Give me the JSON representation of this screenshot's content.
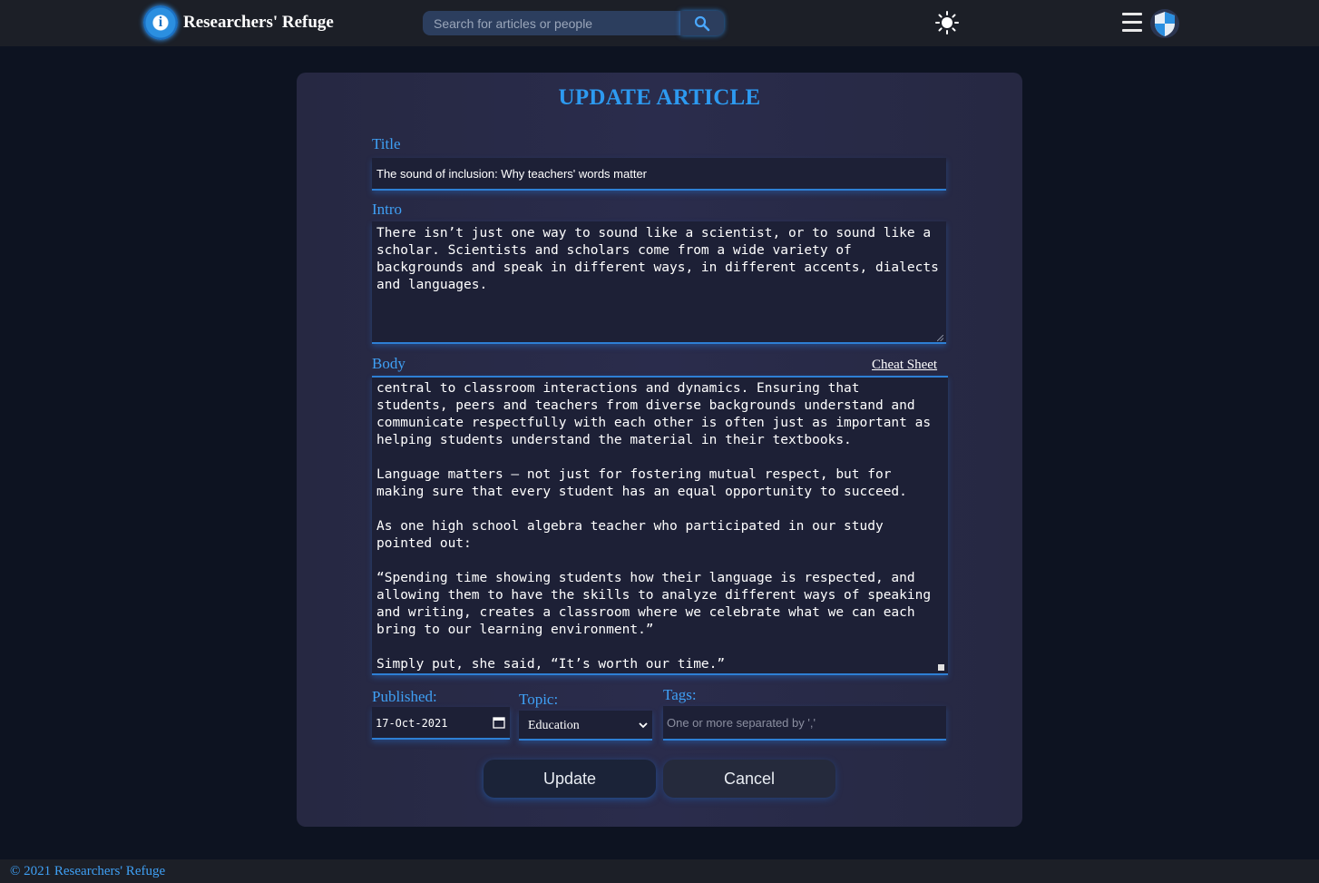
{
  "app": {
    "brand_name": "Researchers' Refuge",
    "search_placeholder": "Search for articles or people"
  },
  "icons": {
    "logo": "logo-icon",
    "search": "search-icon",
    "theme": "sun-icon",
    "menu": "hamburger-menu-icon",
    "profile": "shield-icon",
    "calendar": "calendar-icon",
    "select": "chevron-down-icon"
  },
  "colors": {
    "accent": "#2d9af0",
    "background": "#0d1321",
    "card": "#2a2c4c"
  },
  "form": {
    "heading": "UPDATE ARTICLE",
    "title_label": "Title",
    "title_value": "The sound of inclusion: Why teachers' words matter",
    "intro_label": "Intro",
    "intro_value": "There isn’t just one way to sound like a scientist, or to sound like a\nscholar. Scientists and scholars come from a wide variety of\nbackgrounds and speak in different ways, in different accents, dialects\nand languages.",
    "body_label": "Body",
    "cheat_sheet_label": "Cheat Sheet",
    "body_value": "central to classroom interactions and dynamics. Ensuring that\nstudents, peers and teachers from diverse backgrounds understand and\ncommunicate respectfully with each other is often just as important as\nhelping students understand the material in their textbooks.\n\nLanguage matters – not just for fostering mutual respect, but for\nmaking sure that every student has an equal opportunity to succeed.\n\nAs one high school algebra teacher who participated in our study\npointed out:\n\n“Spending time showing students how their language is respected, and\nallowing them to have the skills to analyze different ways of speaking\nand writing, creates a classroom where we celebrate what we can each\nbring to our learning environment.”\n\nSimply put, she said, “It’s worth our time.”",
    "published_label": "Published:",
    "published_value": "17-Oct-2021",
    "topic_label": "Topic:",
    "topic_value": "Education",
    "tags_label": "Tags:",
    "tags_placeholder": "One or more separated by ','",
    "update_label": "Update",
    "cancel_label": "Cancel"
  },
  "footer": {
    "text": "© 2021 Researchers' Refuge"
  }
}
